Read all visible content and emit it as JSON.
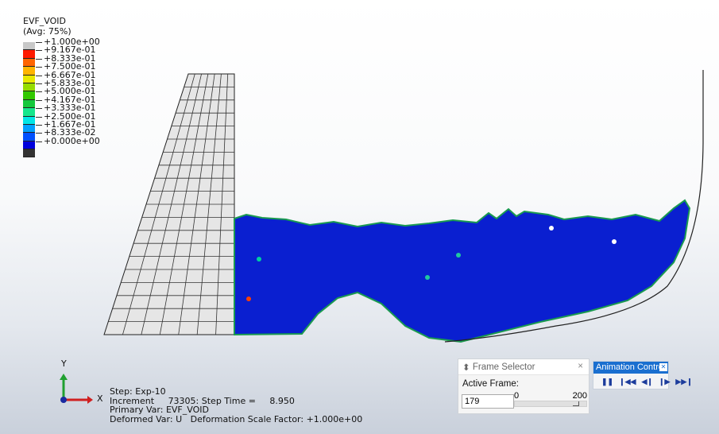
{
  "legend": {
    "title": "EVF_VOID",
    "subtitle": "(Avg: 75%)",
    "colors": [
      "#c8c8c8",
      "#ff1a00",
      "#ff6400",
      "#ffb400",
      "#e8e800",
      "#96dc00",
      "#32c800",
      "#14c83c",
      "#14e68c",
      "#00e6e6",
      "#00a0ff",
      "#0050ff",
      "#0000dc",
      "#333333"
    ],
    "values": [
      "+1.000e+00",
      "+9.167e-01",
      "+8.333e-01",
      "+7.500e-01",
      "+6.667e-01",
      "+5.833e-01",
      "+5.000e-01",
      "+4.167e-01",
      "+3.333e-01",
      "+2.500e-01",
      "+1.667e-01",
      "+8.333e-02",
      "+0.000e+00"
    ]
  },
  "triad": {
    "y": "Y",
    "x": "X"
  },
  "info": {
    "step": "Step: Exp-10",
    "increment": "Increment     73305: Step Time =     8.950",
    "primary": "Primary Var: EVF_VOID",
    "deformed": "Deformed Var: U   Deformation Scale Factor: +1.000e+00"
  },
  "frame_selector": {
    "title": "Frame Selector",
    "label": "Active Frame:",
    "value": "179",
    "min": "0",
    "max": "200",
    "close": "×"
  },
  "animation": {
    "title": "Animation Contro",
    "buttons": [
      "pause",
      "first",
      "previous",
      "next",
      "last"
    ]
  }
}
